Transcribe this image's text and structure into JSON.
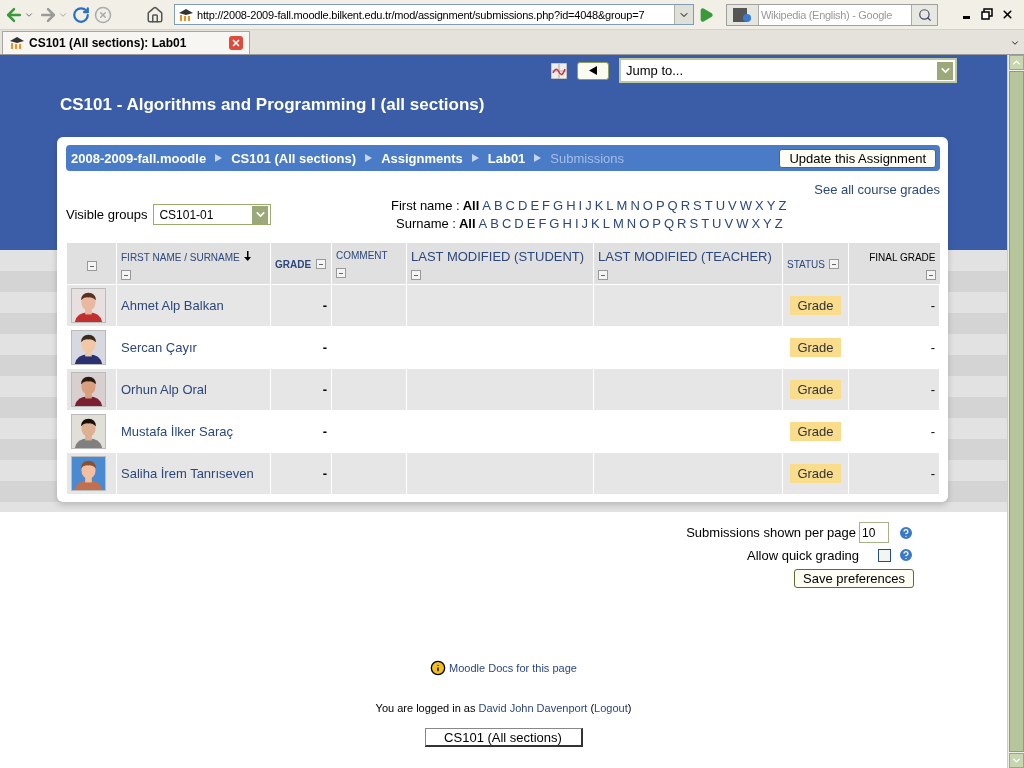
{
  "browser": {
    "url": "http://2008-2009-fall.moodle.bilkent.edu.tr/mod/assignment/submissions.php?id=4048&group=7",
    "search_placeholder": "Wikipedia (English) - Google",
    "tab_title": "CS101 (All sections): Lab01"
  },
  "header": {
    "jump_placeholder": "Jump to...",
    "course_title": "CS101 - Algorithms and Programming I (all sections)"
  },
  "breadcrumb": [
    {
      "label": "2008-2009-fall.moodle",
      "current": false
    },
    {
      "label": "CS101 (All sections)",
      "current": false
    },
    {
      "label": "Assignments",
      "current": false
    },
    {
      "label": "Lab01",
      "current": false
    },
    {
      "label": "Submissions",
      "current": true
    }
  ],
  "update_button": "Update this Assignment",
  "see_all_link": "See all course grades",
  "visible_groups": {
    "label": "Visible groups",
    "value": "CS101-01"
  },
  "filters": [
    {
      "label": "First name :",
      "options": [
        {
          "label": "All",
          "selected": true
        },
        {
          "label": "A",
          "selected": false
        },
        {
          "label": "B",
          "selected": false
        },
        {
          "label": "C",
          "selected": false
        },
        {
          "label": "D",
          "selected": false
        },
        {
          "label": "E",
          "selected": false
        },
        {
          "label": "F",
          "selected": false
        },
        {
          "label": "G",
          "selected": false
        },
        {
          "label": "H",
          "selected": false
        },
        {
          "label": "I",
          "selected": false
        },
        {
          "label": "J",
          "selected": false
        },
        {
          "label": "K",
          "selected": false
        },
        {
          "label": "L",
          "selected": false
        },
        {
          "label": "M",
          "selected": false
        },
        {
          "label": "N",
          "selected": false
        },
        {
          "label": "O",
          "selected": false
        },
        {
          "label": "P",
          "selected": false
        },
        {
          "label": "Q",
          "selected": false
        },
        {
          "label": "R",
          "selected": false
        },
        {
          "label": "S",
          "selected": false
        },
        {
          "label": "T",
          "selected": false
        },
        {
          "label": "U",
          "selected": false
        },
        {
          "label": "V",
          "selected": false
        },
        {
          "label": "W",
          "selected": false
        },
        {
          "label": "X",
          "selected": false
        },
        {
          "label": "Y",
          "selected": false
        },
        {
          "label": "Z",
          "selected": false
        }
      ]
    },
    {
      "label": "Surname :",
      "options": [
        {
          "label": "All",
          "selected": true
        },
        {
          "label": "A",
          "selected": false
        },
        {
          "label": "B",
          "selected": false
        },
        {
          "label": "C",
          "selected": false
        },
        {
          "label": "D",
          "selected": false
        },
        {
          "label": "E",
          "selected": false
        },
        {
          "label": "F",
          "selected": false
        },
        {
          "label": "G",
          "selected": false
        },
        {
          "label": "H",
          "selected": false
        },
        {
          "label": "I",
          "selected": false
        },
        {
          "label": "J",
          "selected": false
        },
        {
          "label": "K",
          "selected": false
        },
        {
          "label": "L",
          "selected": false
        },
        {
          "label": "M",
          "selected": false
        },
        {
          "label": "N",
          "selected": false
        },
        {
          "label": "O",
          "selected": false
        },
        {
          "label": "P",
          "selected": false
        },
        {
          "label": "Q",
          "selected": false
        },
        {
          "label": "R",
          "selected": false
        },
        {
          "label": "S",
          "selected": false
        },
        {
          "label": "T",
          "selected": false
        },
        {
          "label": "U",
          "selected": false
        },
        {
          "label": "V",
          "selected": false
        },
        {
          "label": "W",
          "selected": false
        },
        {
          "label": "X",
          "selected": false
        },
        {
          "label": "Y",
          "selected": false
        },
        {
          "label": "Z",
          "selected": false
        }
      ]
    }
  ],
  "table": {
    "columns": [
      {
        "kind": "picture"
      },
      {
        "kind": "name",
        "parts": [
          "FIRST NAME",
          "/",
          "SURNAME"
        ],
        "sorted": true
      },
      {
        "kind": "small",
        "label": "GRADE",
        "bold": true
      },
      {
        "kind": "small",
        "label": "COMMENT",
        "bold": false
      },
      {
        "kind": "large",
        "label": "LAST MODIFIED (STUDENT)"
      },
      {
        "kind": "large",
        "label": "LAST MODIFIED (TEACHER)"
      },
      {
        "kind": "small",
        "label": "STATUS",
        "bold": false
      },
      {
        "kind": "final",
        "label": "FINAL GRADE"
      }
    ],
    "rows": [
      {
        "name": "Ahmet Alp Balkan",
        "grade": "-",
        "status": "Grade",
        "final_grade": "-"
      },
      {
        "name": "Sercan Çayır",
        "grade": "-",
        "status": "Grade",
        "final_grade": "-"
      },
      {
        "name": "Orhun Alp Oral",
        "grade": "-",
        "status": "Grade",
        "final_grade": "-"
      },
      {
        "name": "Mustafa İlker Saraç",
        "grade": "-",
        "status": "Grade",
        "final_grade": "-"
      },
      {
        "name": "Saliha İrem Tanrıseven",
        "grade": "-",
        "status": "Grade",
        "final_grade": "-"
      }
    ]
  },
  "preferences": {
    "per_page_label": "Submissions shown per page",
    "per_page_value": "10",
    "quick_grading_label": "Allow quick grading",
    "quick_grading": false,
    "save_button": "Save preferences"
  },
  "footer": {
    "docs_link": "Moodle Docs for this page",
    "login": [
      {
        "text": "You are logged in as ",
        "link": false
      },
      {
        "text": "David John Davenport",
        "link": true
      },
      {
        "text": " (",
        "link": false
      },
      {
        "text": "Logout",
        "link": true
      },
      {
        "text": ")",
        "link": false
      }
    ],
    "course_button": "CS101 (All sections)"
  }
}
